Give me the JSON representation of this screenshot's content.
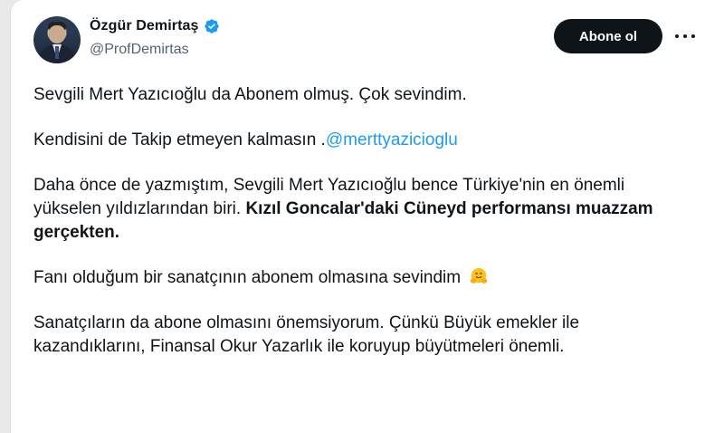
{
  "tweet": {
    "author": {
      "display_name": "Özgür Demirtaş",
      "handle": "@ProfDemirtas",
      "verified_icon": "verified-badge-icon",
      "avatar": "avatar-photo"
    },
    "follow_label": "Abone ol",
    "more_icon": "more-options-icon",
    "paragraphs": {
      "p1": "Sevgili Mert Yazıcıoğlu da Abonem olmuş. Çok sevindim.",
      "p2_text": "Kendisini de Takip etmeyen kalmasın .",
      "p2_mention": "@merttyazicioglu",
      "p3_text": "Daha önce de yazmıştım, Sevgili Mert Yazıcıoğlu bence Türkiye'nin en önemli yükselen yıldızlarından biri. ",
      "p3_bold": "Kızıl Goncalar'daki Cüneyd performansı muazzam gerçekten.",
      "p4": "Fanı olduğum bir sanatçının abonem olmasına sevindim",
      "p4_emoji": "hugging-face-emoji",
      "p5": "Sanatçıların da abone olmasını önemsiyorum. Çünkü Büyük emekler ile kazandıklarını, Finansal Okur Yazarlık ile koruyup büyütmeleri önemli."
    },
    "colors": {
      "mention": "#1d9bf0",
      "text": "#0f1419",
      "secondary": "#536471",
      "button_bg": "#0f1419",
      "verified": "#1d9bf0"
    }
  }
}
